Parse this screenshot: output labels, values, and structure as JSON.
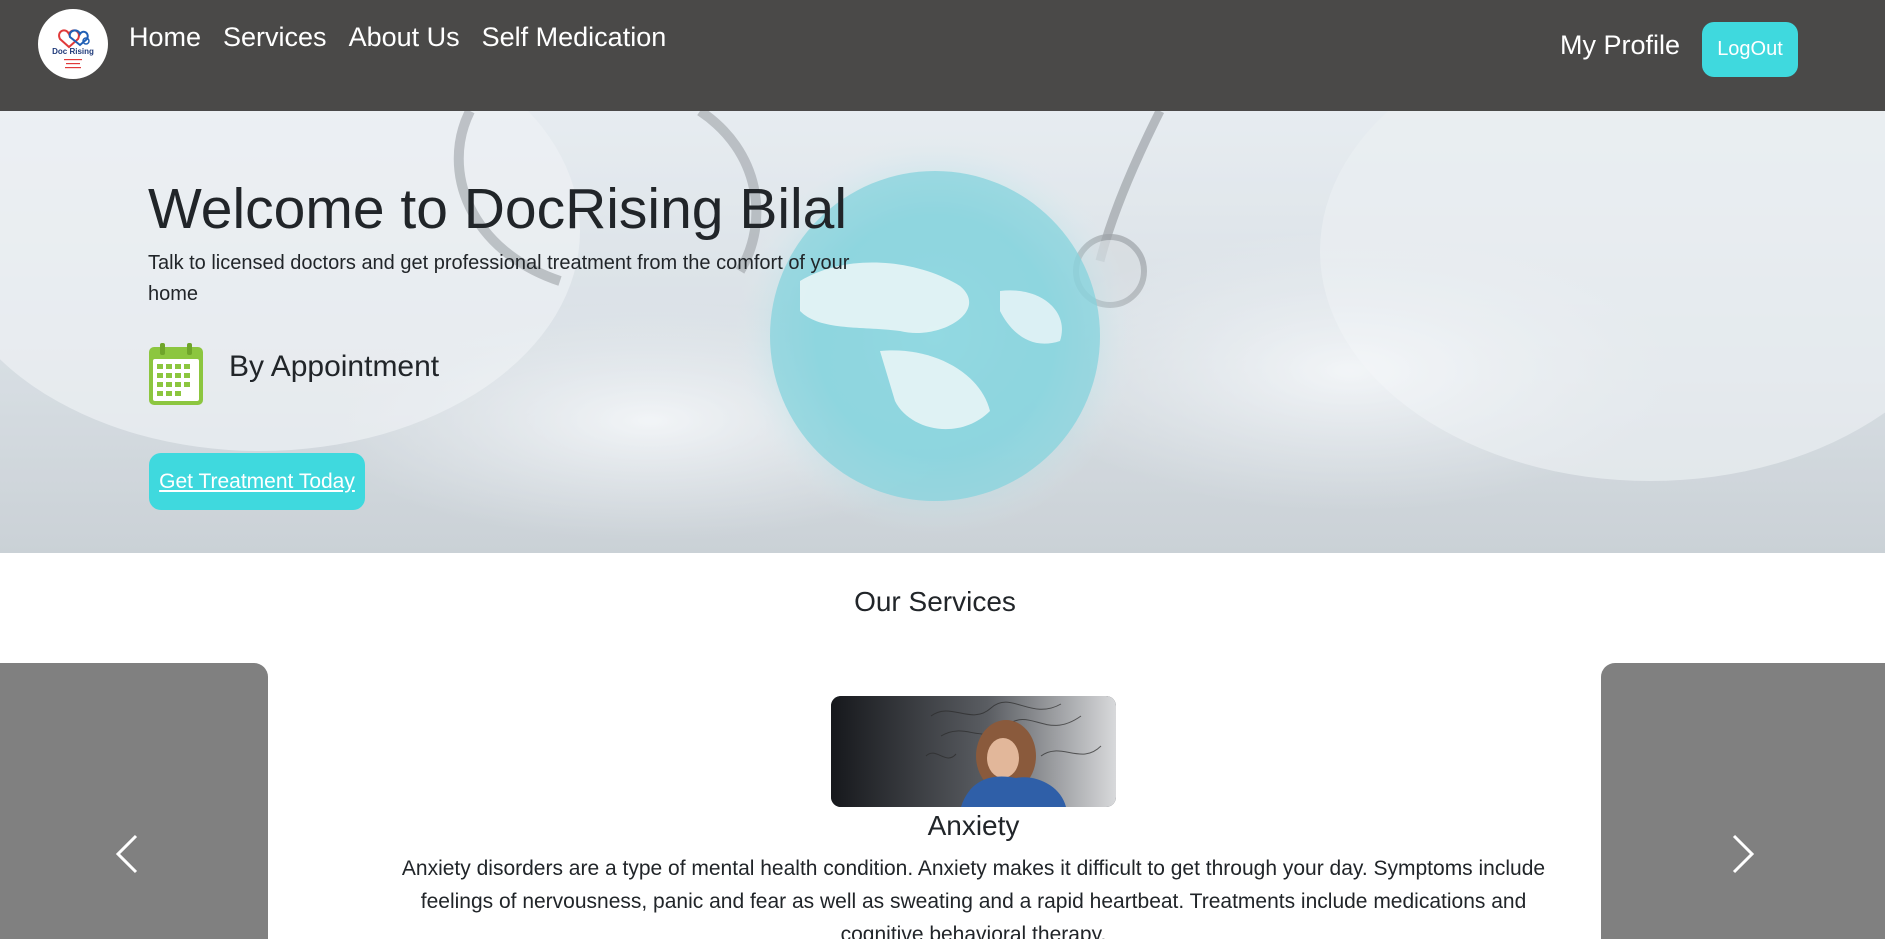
{
  "navbar": {
    "logo_text": "Doc Rising",
    "links": [
      "Home",
      "Services",
      "About Us",
      "Self Medication"
    ],
    "profile_label": "My Profile",
    "logout_label": "LogOut"
  },
  "hero": {
    "title": "Welcome to DocRising Bilal",
    "subtitle": "Talk to licensed doctors and get professional treatment from the comfort of your home",
    "appointment_label": "By Appointment",
    "cta_label": "Get Treatment Today"
  },
  "services": {
    "section_title": "Our Services",
    "current": {
      "name": "Anxiety",
      "description": "Anxiety disorders are a type of mental health condition. Anxiety makes it difficult to get through your day. Symptoms include feelings of nervousness, panic and fear as well as sweating and a rapid heartbeat. Treatments include medications and cognitive behavioral therapy."
    }
  },
  "colors": {
    "navbar_bg": "#4a4948",
    "accent": "#3fd9de",
    "carousel_control_bg": "#808080",
    "calendar_icon": "#8cc63f"
  },
  "icons": [
    "calendar-icon",
    "chevron-left-icon",
    "chevron-right-icon"
  ]
}
